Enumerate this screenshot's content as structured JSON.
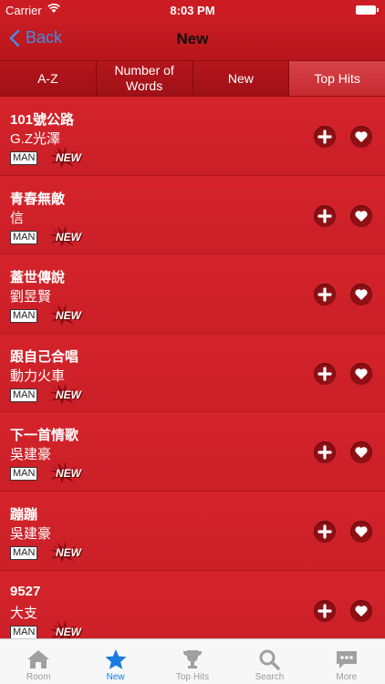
{
  "status_bar": {
    "carrier": "Carrier",
    "time": "8:03 PM"
  },
  "nav": {
    "back_label": "Back",
    "title": "New"
  },
  "segments": [
    {
      "label": "A-Z",
      "active": false
    },
    {
      "label": "Number of Words",
      "active": false
    },
    {
      "label": "New",
      "active": false
    },
    {
      "label": "Top Hits",
      "active": true
    }
  ],
  "songs": [
    {
      "title": "101號公路",
      "artist": "G.Z光澤",
      "badge": "MAN",
      "new_tag": "NEW"
    },
    {
      "title": "青春無敵",
      "artist": "信",
      "badge": "MAN",
      "new_tag": "NEW"
    },
    {
      "title": "蓋世傳說",
      "artist": "劉昱賢",
      "badge": "MAN",
      "new_tag": "NEW"
    },
    {
      "title": "跟自己合唱",
      "artist": "動力火車",
      "badge": "MAN",
      "new_tag": "NEW"
    },
    {
      "title": "下一首情歌",
      "artist": "吳建豪",
      "badge": "MAN",
      "new_tag": "NEW"
    },
    {
      "title": "蹦蹦",
      "artist": "吳建豪",
      "badge": "MAN",
      "new_tag": "NEW"
    },
    {
      "title": "9527",
      "artist": "大支",
      "badge": "MAN",
      "new_tag": "NEW"
    }
  ],
  "row_actions": {
    "add_icon": "plus-circle-icon",
    "favorite_icon": "heart-icon"
  },
  "tab_bar": [
    {
      "label": "Room",
      "icon": "house-icon",
      "active": false
    },
    {
      "label": "New",
      "icon": "star-icon",
      "active": true
    },
    {
      "label": "Top Hits",
      "icon": "trophy-icon",
      "active": false
    },
    {
      "label": "Search",
      "icon": "magnifier-icon",
      "active": false
    },
    {
      "label": "More",
      "icon": "chat-bubble-icon",
      "active": false
    }
  ],
  "colors": {
    "primary_red": "#d0202a",
    "nav_back_blue": "#3d8fe6",
    "tab_active_blue": "#1a7be0"
  }
}
